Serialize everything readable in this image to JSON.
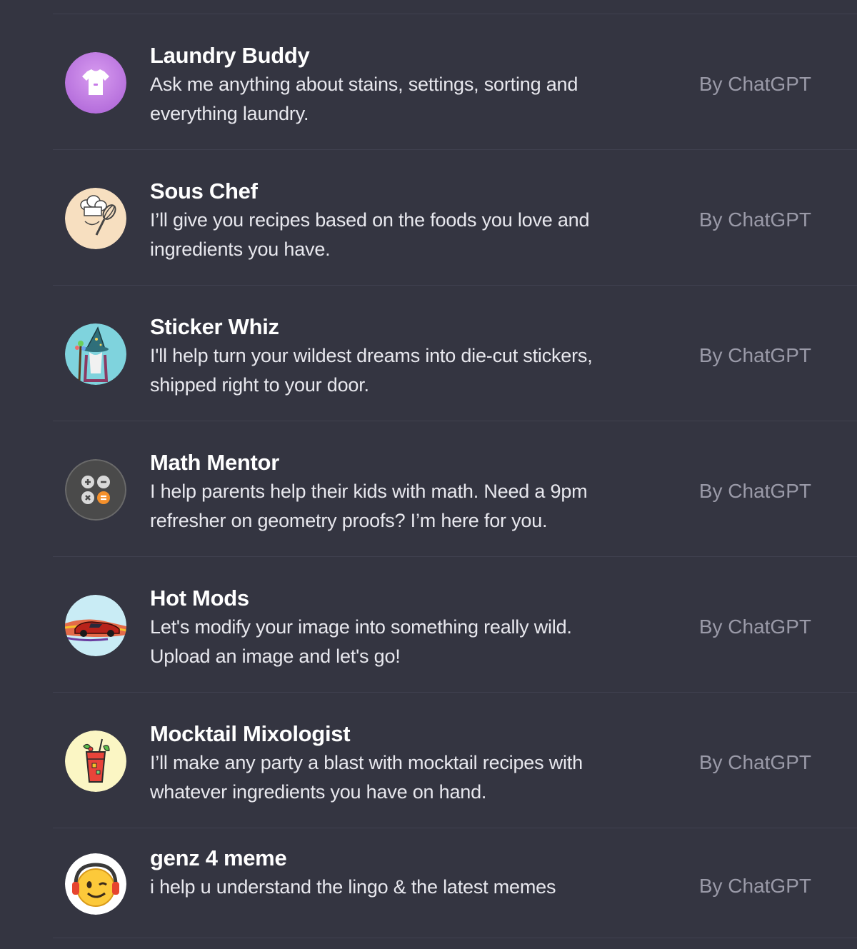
{
  "gpts": [
    {
      "name": "Laundry Buddy",
      "description_line1": "Ask me anything about stains, settings, sorting and",
      "description_line2": "everything laundry.",
      "author": "By ChatGPT",
      "icon": "tshirt-icon",
      "icon_color": "#c77be8"
    },
    {
      "name": "Sous Chef",
      "description_line1": "I’ll give you recipes based on the foods you love and",
      "description_line2": "ingredients you have.",
      "author": "By ChatGPT",
      "icon": "chef-hat-whisk-icon",
      "icon_color": "#f7dfc0"
    },
    {
      "name": "Sticker Whiz",
      "description_line1": "I'll help turn your wildest dreams into die-cut stickers,",
      "description_line2": "shipped right to your door.",
      "author": "By ChatGPT",
      "icon": "wizard-icon",
      "icon_color": "#7fd3dd"
    },
    {
      "name": "Math Mentor",
      "description_line1": "I help parents help their kids with math. Need a 9pm",
      "description_line2": "refresher on geometry proofs? I’m here for you.",
      "author": "By ChatGPT",
      "icon": "calculator-icon",
      "icon_color": "#4a4a4a"
    },
    {
      "name": "Hot Mods",
      "description_line1": "Let's modify your image into something really wild.",
      "description_line2": "Upload an image and let's go!",
      "author": "By ChatGPT",
      "icon": "race-car-icon",
      "icon_color": "#c9ecf5"
    },
    {
      "name": "Mocktail Mixologist",
      "description_line1": "I’ll make any party a blast with mocktail recipes with",
      "description_line2": "whatever ingredients you have on hand.",
      "author": "By ChatGPT",
      "icon": "mocktail-glass-icon",
      "icon_color": "#fbf6c4"
    },
    {
      "name": "genz 4 meme",
      "description_line1": "i help u understand the lingo & the latest memes",
      "description_line2": "",
      "author": "By ChatGPT",
      "icon": "winking-emoji-headphones-icon",
      "icon_color": "#ffffff"
    }
  ]
}
